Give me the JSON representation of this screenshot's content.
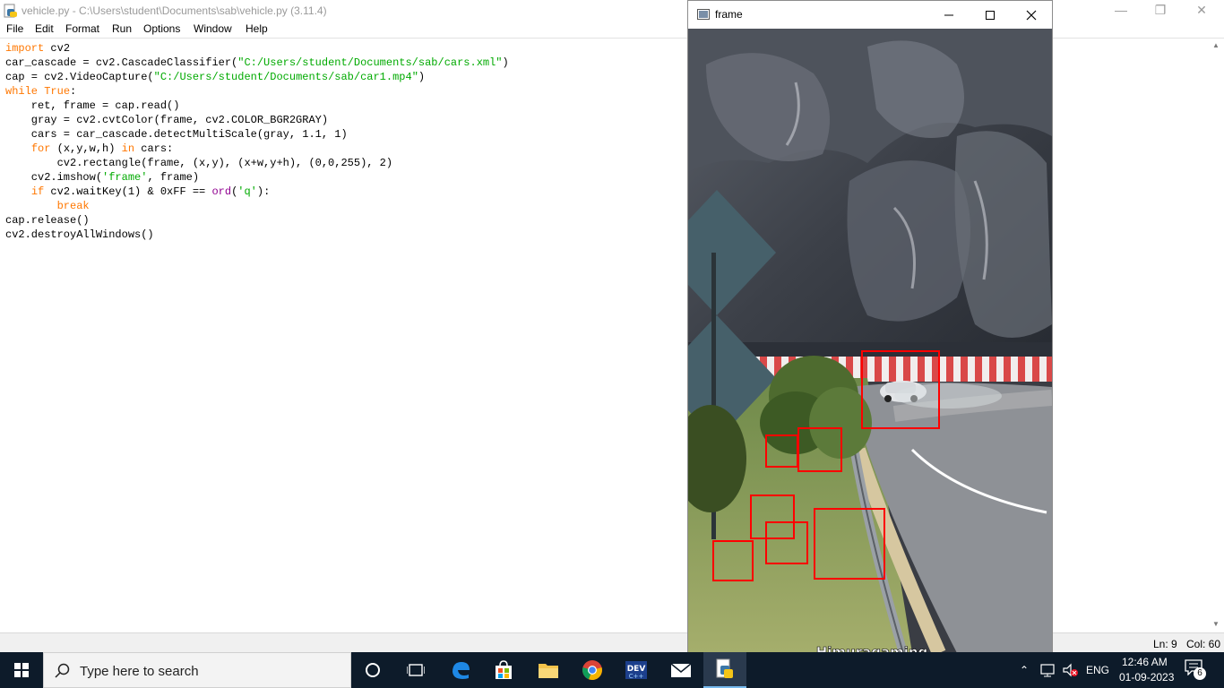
{
  "idle": {
    "title": "vehicle.py - C:\\Users\\student\\Documents\\sab\\vehicle.py (3.11.4)",
    "menu": [
      "File",
      "Edit",
      "Format",
      "Run",
      "Options",
      "Window",
      "Help"
    ],
    "status": {
      "line": "Ln: 9",
      "col": "Col: 60"
    }
  },
  "code": [
    [
      {
        "t": "import",
        "c": "kw"
      },
      {
        "t": " cv2"
      }
    ],
    [
      {
        "t": "car_cascade = cv2.CascadeClassifier("
      },
      {
        "t": "\"C:/Users/student/Documents/sab/cars.xml\"",
        "c": "str"
      },
      {
        "t": ")"
      }
    ],
    [
      {
        "t": "cap = cv2.VideoCapture("
      },
      {
        "t": "\"C:/Users/student/Documents/sab/car1.mp4\"",
        "c": "str"
      },
      {
        "t": ")"
      }
    ],
    [
      {
        "t": "while",
        "c": "kw"
      },
      {
        "t": " "
      },
      {
        "t": "True",
        "c": "kw"
      },
      {
        "t": ":"
      }
    ],
    [
      {
        "t": "    ret, frame = cap.read()"
      }
    ],
    [
      {
        "t": "    gray = cv2.cvtColor(frame, cv2.COLOR_BGR2GRAY)"
      }
    ],
    [
      {
        "t": "    cars = car_cascade.detectMultiScale(gray, 1.1, 1)"
      }
    ],
    [
      {
        "t": "    "
      },
      {
        "t": "for",
        "c": "kw"
      },
      {
        "t": " (x,y,w,h) "
      },
      {
        "t": "in",
        "c": "kw"
      },
      {
        "t": " cars:"
      }
    ],
    [
      {
        "t": "        cv2.rectangle(frame, (x,y), (x+w,y+h), (0,0,255), 2)"
      }
    ],
    [
      {
        "t": "    cv2.imshow("
      },
      {
        "t": "'frame'",
        "c": "str"
      },
      {
        "t": ", frame)"
      }
    ],
    [
      {
        "t": "    "
      },
      {
        "t": "if",
        "c": "kw"
      },
      {
        "t": " cv2.waitKey(1) & 0xFF == "
      },
      {
        "t": "ord",
        "c": "bi"
      },
      {
        "t": "("
      },
      {
        "t": "'q'",
        "c": "str"
      },
      {
        "t": "):"
      }
    ],
    [
      {
        "t": "        "
      },
      {
        "t": "break",
        "c": "kw"
      }
    ],
    [
      {
        "t": "cap.release()"
      }
    ],
    [
      {
        "t": "cv2.destroyAllWindows()"
      }
    ]
  ],
  "frame_window": {
    "title": "frame",
    "watermark": "Himuragaming"
  },
  "taskbar": {
    "search_placeholder": "Type here to search",
    "language": "ENG",
    "time": "12:46 AM",
    "date": "01-09-2023",
    "notifications": "6",
    "apps": [
      "task-view",
      "edge",
      "store",
      "file-explorer",
      "chrome",
      "dev-cpp",
      "mail",
      "python-idle"
    ]
  },
  "colors": {
    "keyword": "#ff7700",
    "string": "#00aa00",
    "builtin": "#900090",
    "detection_box": "#ff0000",
    "taskbar": "#0d1b2a"
  }
}
